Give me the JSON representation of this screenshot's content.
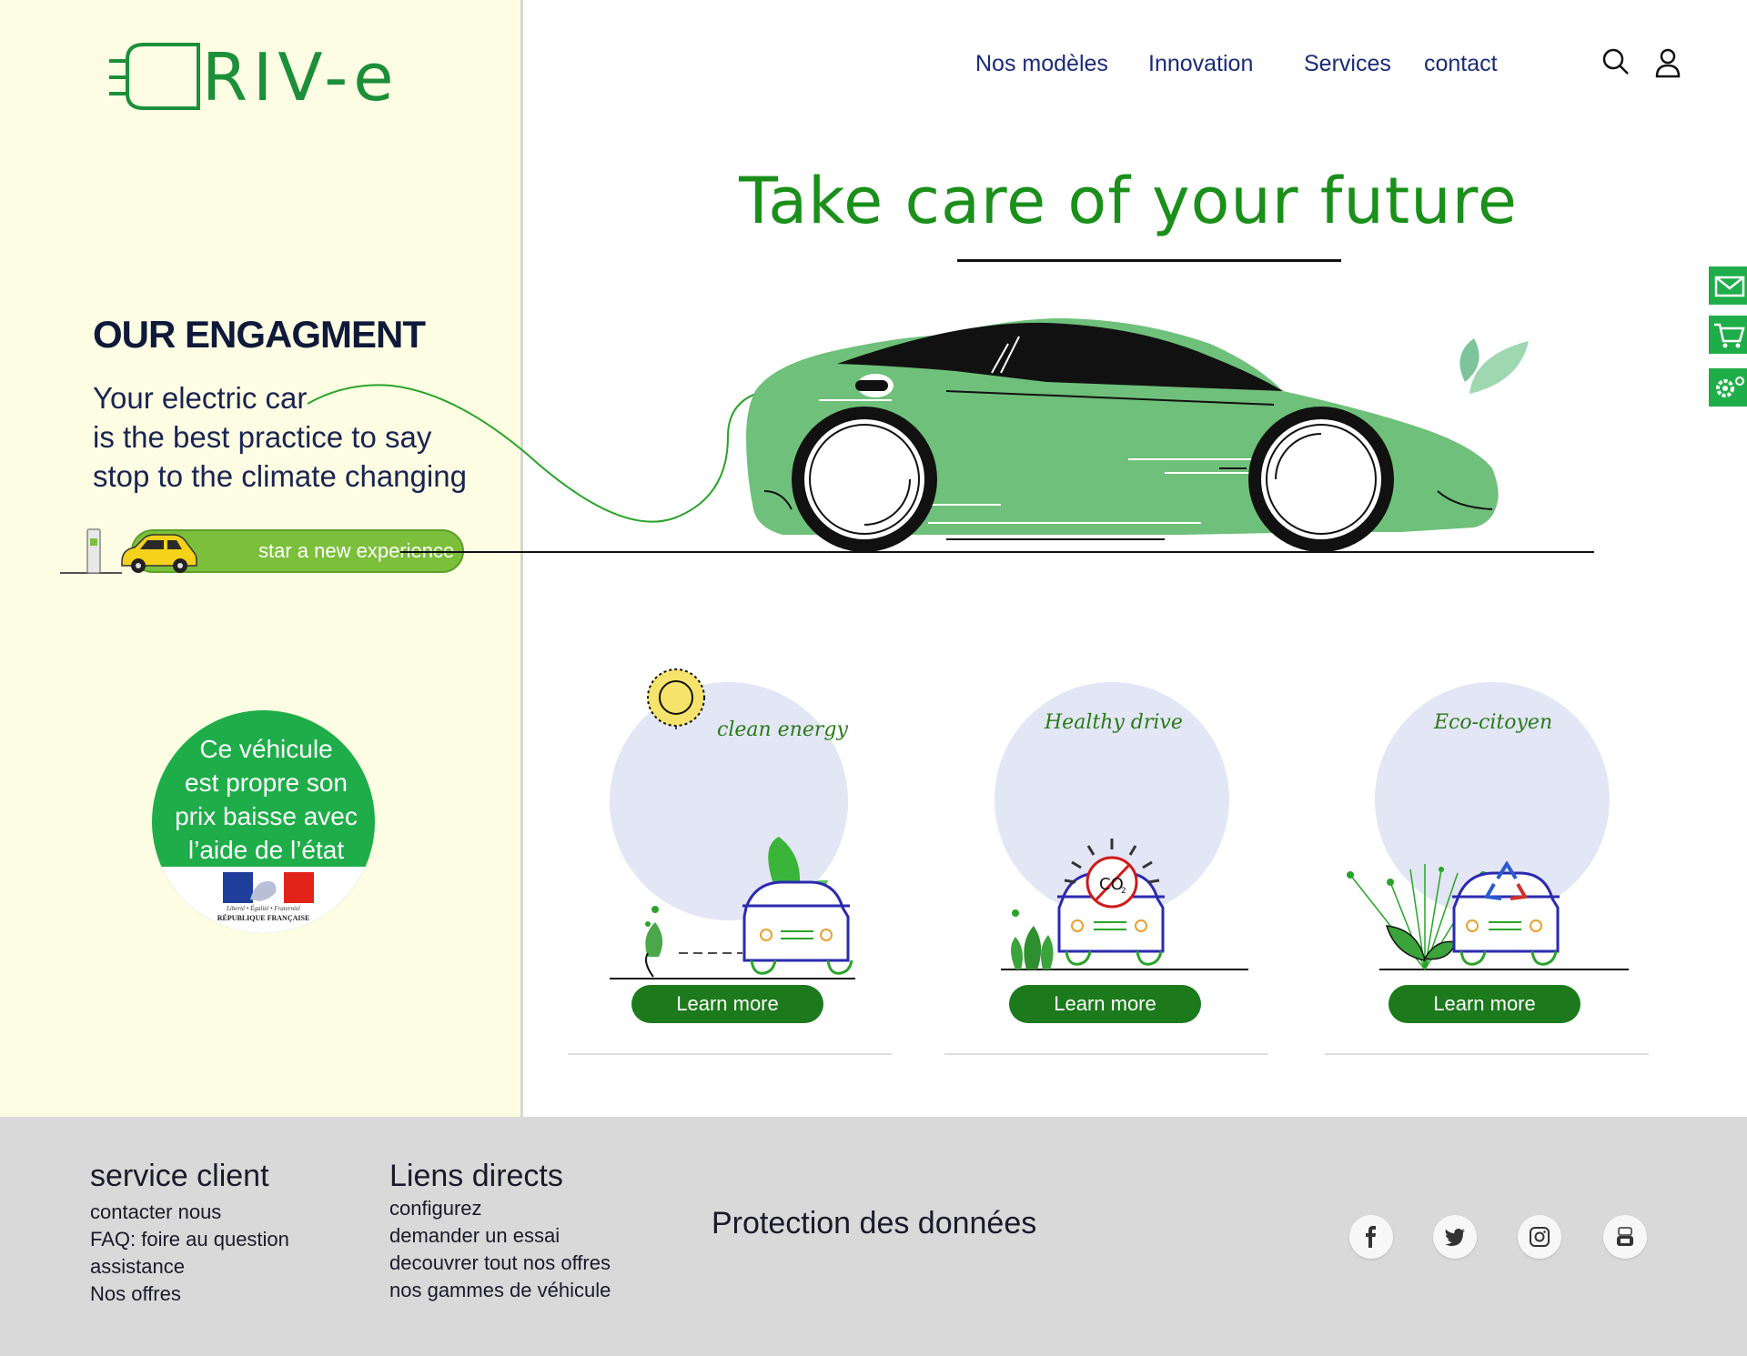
{
  "brand": {
    "logo_text": "RIV-e",
    "color": "#1c8f3a"
  },
  "nav": {
    "items": [
      {
        "label": "Nos modèles"
      },
      {
        "label": "Innovation"
      },
      {
        "label": "Services"
      },
      {
        "label": "contact"
      }
    ],
    "icons": [
      "search-icon",
      "user-icon"
    ],
    "color": "#1a2a7a"
  },
  "hero": {
    "title": "Take care of your future",
    "title_color": "#1a8f1a"
  },
  "engagement": {
    "title": "OUR ENGAGMENT",
    "lines": [
      "Your electric car",
      "is the best practice to say",
      "stop to the climate changing"
    ],
    "cta_label": "star a new experience"
  },
  "badge": {
    "lines": [
      "Ce  véhicule",
      "est propre son",
      "prix baisse avec",
      "l’aide de l’état"
    ],
    "flag_caption": "Liberté • Égalité • Fraternité",
    "flag_name": "RÉPUBLIQUE FRANÇAISE"
  },
  "side_buttons": [
    "mail-icon",
    "cart-icon",
    "settings-icon"
  ],
  "features": [
    {
      "label": "clean energy",
      "button": "Learn more"
    },
    {
      "label": "Healthy drive",
      "button": "Learn more",
      "co2": "CO"
    },
    {
      "label": "Eco-citoyen",
      "button": "Learn more"
    }
  ],
  "footer": {
    "col1": {
      "title": "service client",
      "links": [
        "contacter nous",
        "FAQ: foire au question",
        "assistance",
        "Nos offres"
      ]
    },
    "col2": {
      "title": "Liens directs",
      "links": [
        "configurez",
        "demander un essai",
        "decouvrer tout nos offres",
        "nos gammes de véhicule"
      ]
    },
    "col3": {
      "title": "Protection des données"
    },
    "social": [
      "facebook-icon",
      "twitter-icon",
      "instagram-icon",
      "youtube-icon"
    ]
  },
  "colors": {
    "panel": "#fdfde3",
    "accent_green": "#1fad4a",
    "car_green": "#6fc07a",
    "footer": "#d9d9d9"
  }
}
